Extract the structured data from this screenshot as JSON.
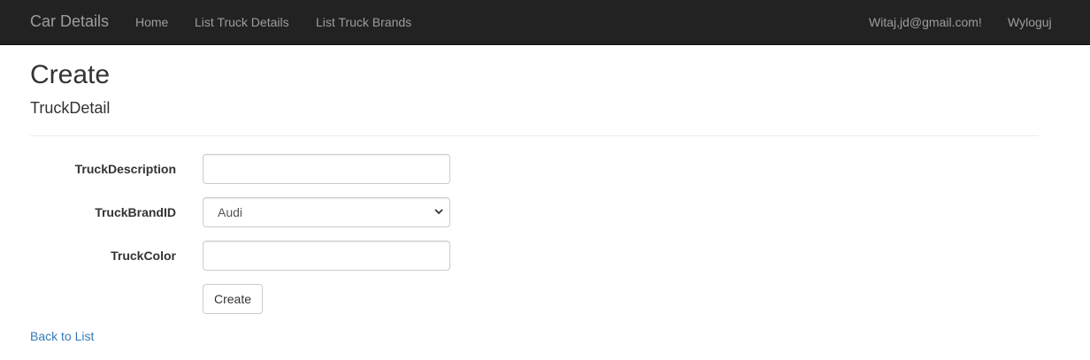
{
  "navbar": {
    "brand": "Car Details",
    "links": [
      "Home",
      "List Truck Details",
      "List Truck Brands"
    ],
    "user_greeting": "Witaj,jd@gmail.com!",
    "logout": "Wyloguj"
  },
  "page": {
    "title": "Create",
    "subtitle": "TruckDetail"
  },
  "form": {
    "description_label": "TruckDescription",
    "description_value": "",
    "brand_label": "TruckBrandID",
    "brand_selected": "Audi",
    "color_label": "TruckColor",
    "color_value": "",
    "submit_label": "Create"
  },
  "footer": {
    "back_link": "Back to List"
  },
  "colors": {
    "navbar_bg": "#222222",
    "link": "#337ab7"
  }
}
